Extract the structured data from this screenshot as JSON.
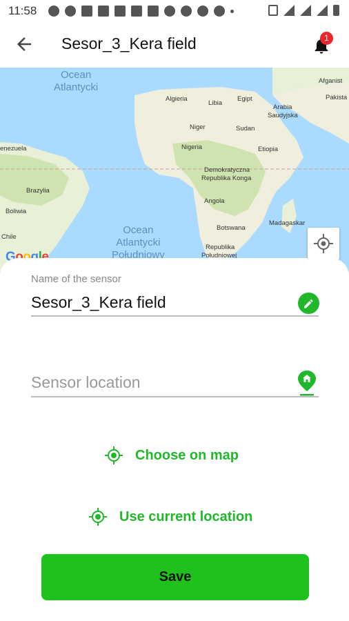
{
  "status_bar": {
    "time": "11:58"
  },
  "header": {
    "title": "Sesor_3_Kera field",
    "notification_count": "1"
  },
  "map": {
    "labels": {
      "ocean_atl_north_1": "Ocean",
      "ocean_atl_north_2": "Atlantycki",
      "ocean_atl_south_1": "Ocean",
      "ocean_atl_south_2": "Atlantycki",
      "ocean_atl_south_3": "Południowy",
      "algieria": "Algieria",
      "libia": "Libia",
      "egipt": "Egipt",
      "arabia_1": "Arabia",
      "arabia_2": "Saudyjska",
      "niger": "Niger",
      "sudan": "Sudan",
      "nigeria": "Nigeria",
      "etiopia": "Etiopia",
      "wenezuela": "enezuela",
      "drc_1": "Demokratyczna",
      "drc_2": "Republika Konga",
      "brazylia": "Brazylia",
      "boliwia": "Boliwia",
      "angola": "Angola",
      "botswana": "Botswana",
      "madagaskar": "Madagaskar",
      "rpa_1": "Republika",
      "rpa_2": "Południowej",
      "afganistan": "Afganist",
      "pakistan": "Pakista",
      "chile": "Chile"
    },
    "attribution": "Google"
  },
  "form": {
    "name_label": "Name of the sensor",
    "name_value": "Sesor_3_Kera field",
    "location_placeholder": "Sensor location"
  },
  "actions": {
    "choose_on_map": "Choose on map",
    "use_current_location": "Use current location",
    "save": "Save"
  },
  "colors": {
    "accent": "#20b82a",
    "save_button": "#1fc21c",
    "badge": "#e8262d",
    "water": "#aadaff",
    "land": "#e8f1d8"
  },
  "icons": {
    "back": "arrow-left-icon",
    "bell": "bell-icon",
    "edit": "pencil-icon",
    "location_pin": "home-pin-icon",
    "target": "crosshair-icon",
    "my_location": "my-location-icon"
  }
}
